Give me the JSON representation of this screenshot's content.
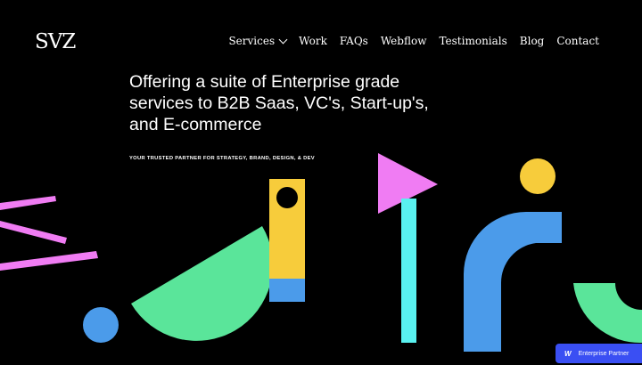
{
  "brand": {
    "logo_text": "SVZ"
  },
  "nav": {
    "items": [
      {
        "label": "Services",
        "has_dropdown": true
      },
      {
        "label": "Work"
      },
      {
        "label": "FAQs"
      },
      {
        "label": "Webflow"
      },
      {
        "label": "Testimonials"
      },
      {
        "label": "Blog"
      },
      {
        "label": "Contact"
      }
    ]
  },
  "hero": {
    "headline": "Offering a suite of Enterprise grade services to B2B Saas, VC's, Start-up's, and E-commerce",
    "tagline": "YOUR TRUSTED PARTNER FOR STRATEGY, BRAND, DESIGN, & DEV"
  },
  "badge": {
    "icon": "W",
    "label": "Enterprise Partner"
  },
  "colors": {
    "background": "#000000",
    "pink": "#f07cf3",
    "green": "#5ae59a",
    "yellow": "#f7cc3b",
    "blue": "#4b9bea",
    "cyan": "#59f1f0",
    "badge": "#3a4ff3"
  }
}
